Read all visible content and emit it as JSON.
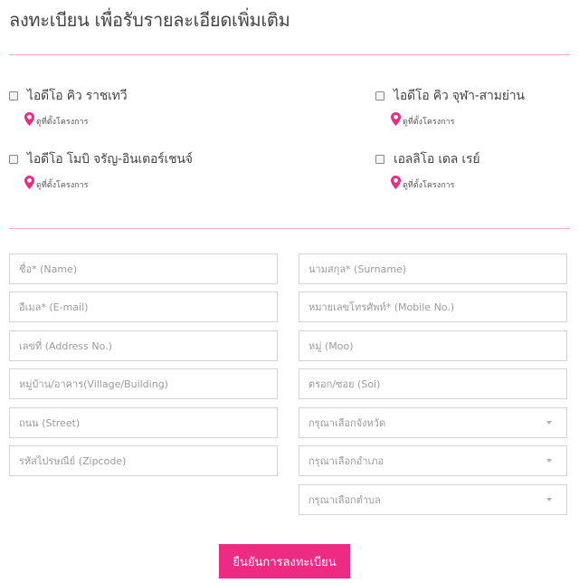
{
  "form": {
    "title": "ลงทะเบียน เพื่อรับรายละเอียดเพิ่มเติม",
    "projects": [
      {
        "name": "ไอดีโอ คิว ราชเทวี",
        "location_label": "ดูที่ตั้งโครงการ"
      },
      {
        "name": "ไอดีโอ คิว จุฬา-สามย่าน",
        "location_label": "ดูที่ตั้งโครงการ"
      },
      {
        "name": "ไอดีโอ โมบิ จรัญ-อินเตอร์เชนจ์",
        "location_label": "ดูที่ตั้งโครงการ"
      },
      {
        "name": "เอลลิโอ เดล เรย์",
        "location_label": "ดูที่ตั้งโครงการ"
      }
    ],
    "fields": {
      "name": "ชื่อ* (Name)",
      "surname": "นามสกุล* (Surname)",
      "email": "อีเมล* (E-mail)",
      "mobile": "หมายเลขโทรศัพท์* (Mobile No.)",
      "address_no": "เลขที่ (Address No.)",
      "moo": "หมู่ (Moo)",
      "village": "หมู่บ้าน/อาคาร(Village/Building)",
      "soi": "ตรอก/ซอย (Soi)",
      "street": "ถนน (Street)",
      "province": "กรุณาเลือกจังหวัด",
      "zipcode": "รหัสไปรษณีย์ (Zipcode)",
      "district": "กรุณาเลือกอำเภอ",
      "subdistrict": "กรุณาเลือกตำบล"
    },
    "submit_label": "ยืนยันการลงทะเบียน"
  },
  "colors": {
    "accent": "#ee2b82",
    "divider": "#f2a7c0"
  }
}
